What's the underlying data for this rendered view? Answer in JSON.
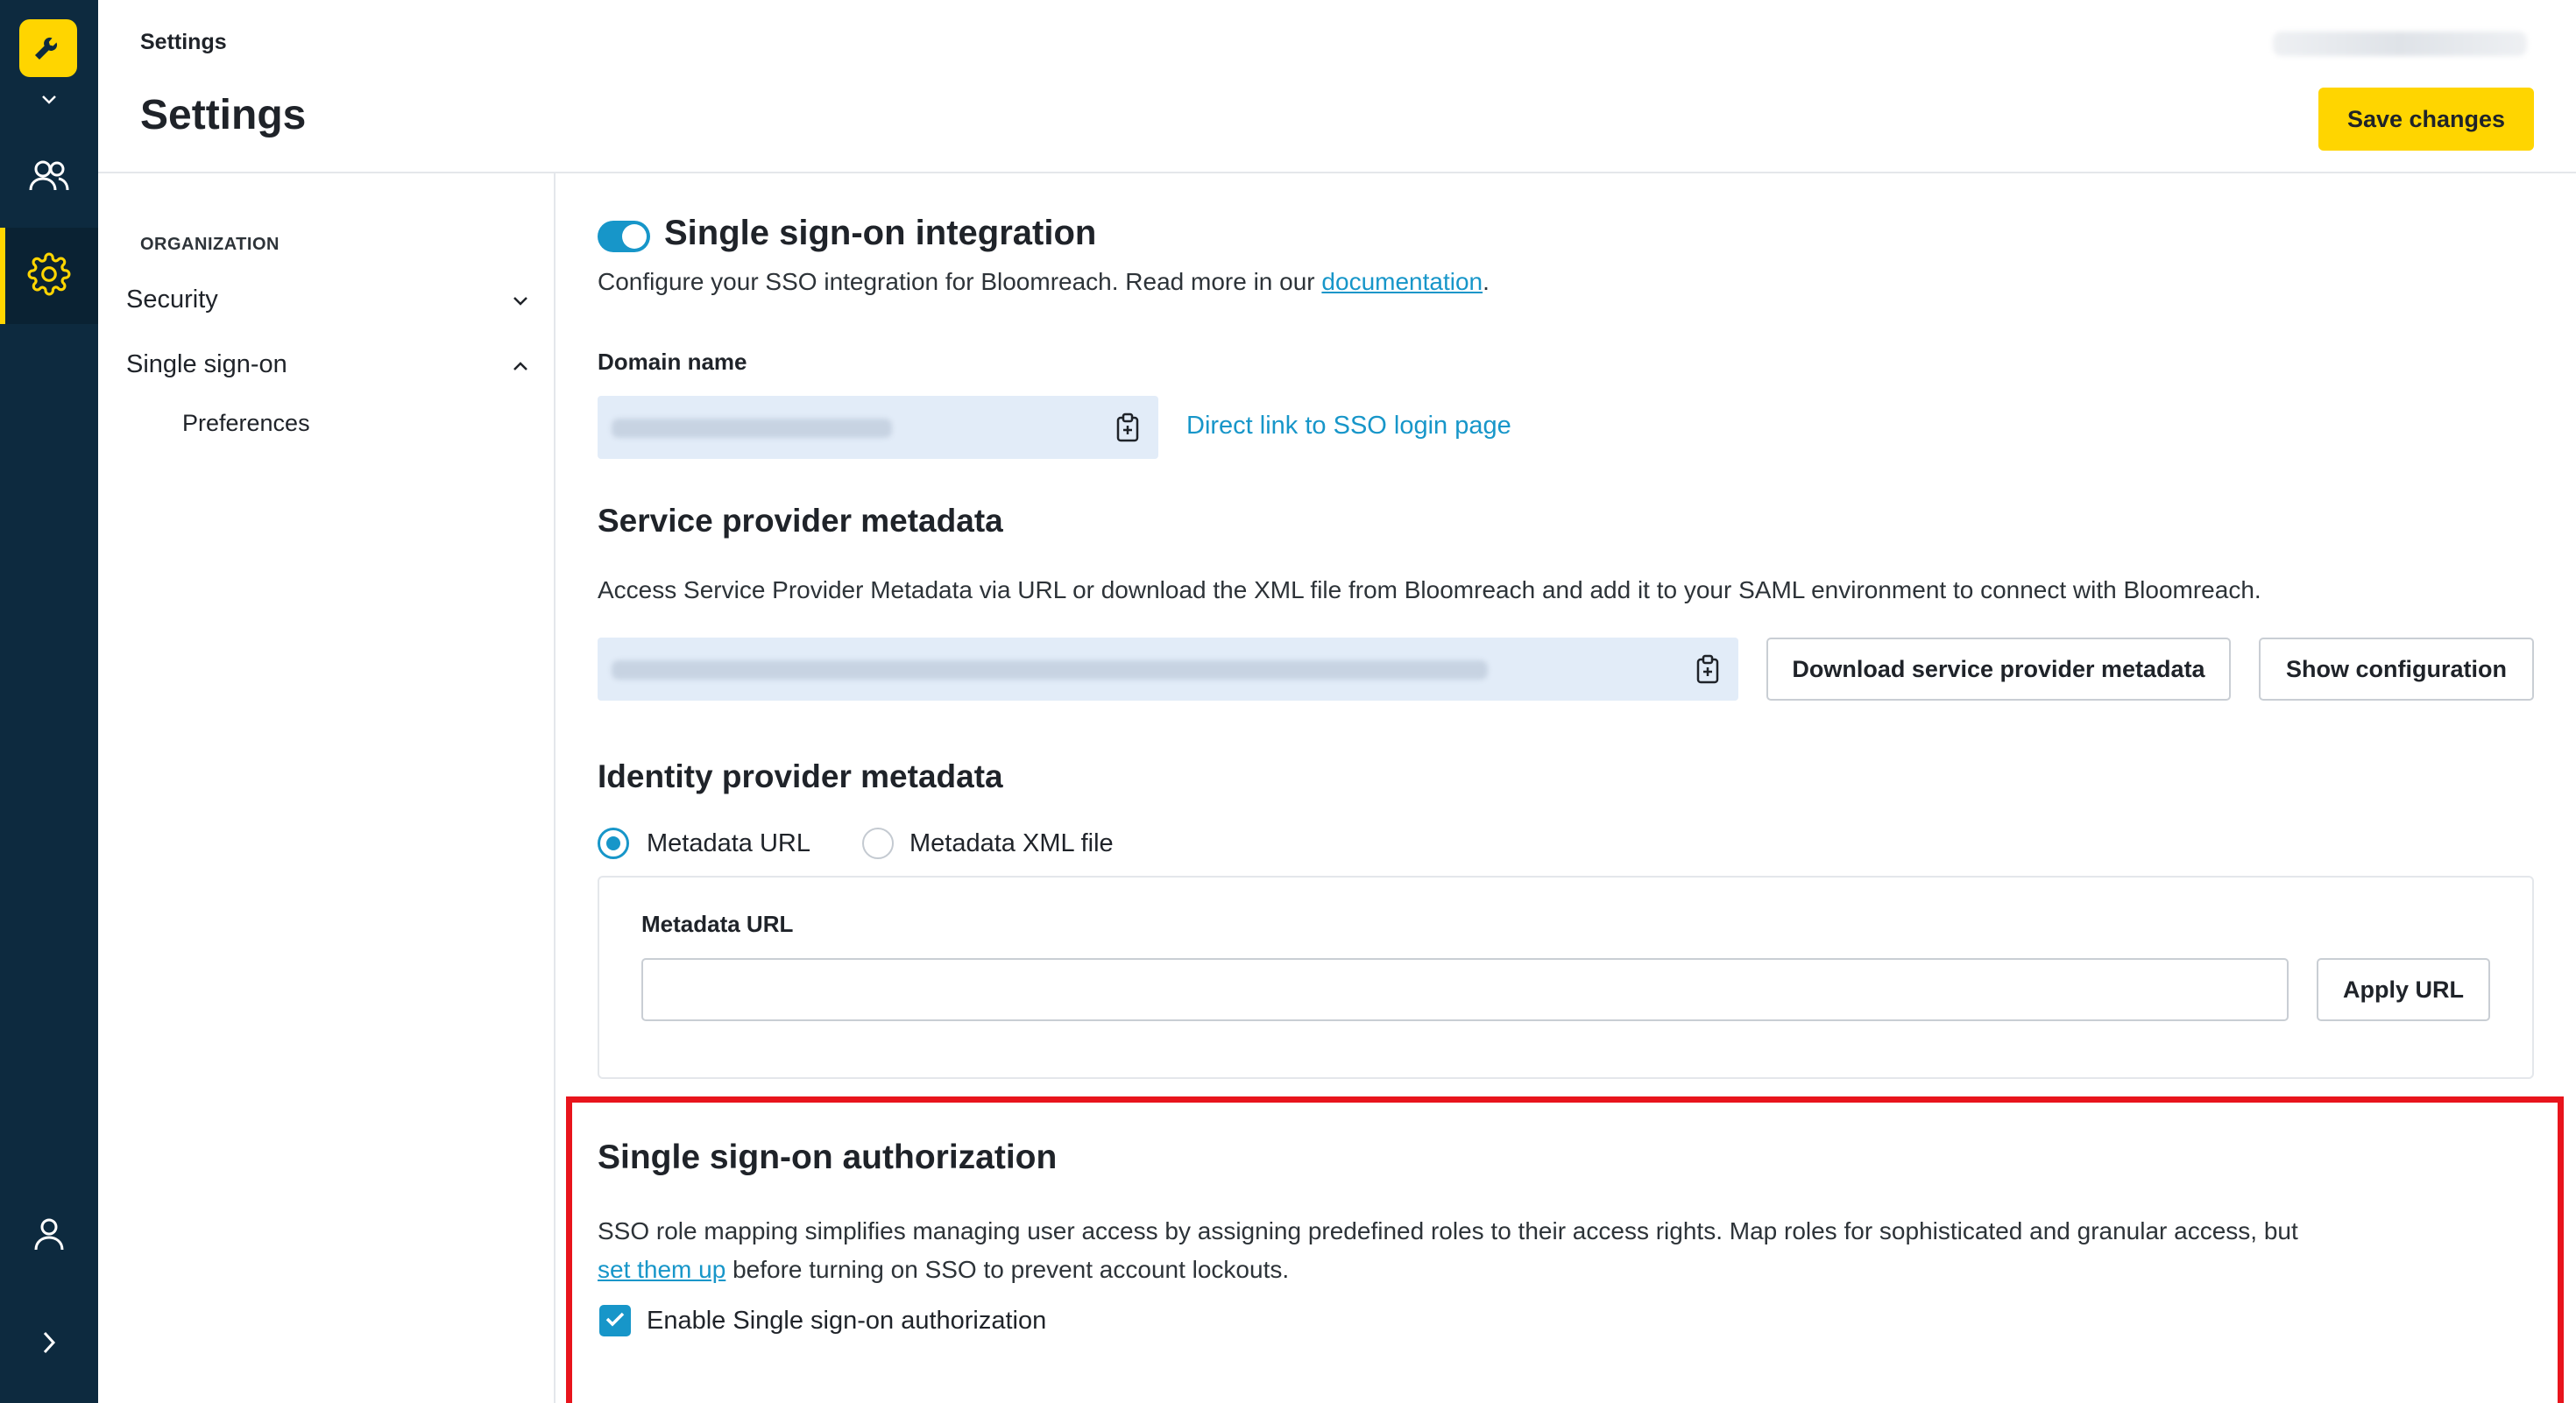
{
  "header": {
    "breadcrumb": "Settings",
    "title": "Settings",
    "save_label": "Save changes"
  },
  "rail": {
    "icons": [
      "wrench-icon",
      "chevron-down-icon",
      "users-icon",
      "gear-icon",
      "user-icon",
      "chevron-right-icon"
    ],
    "accent": "#ffd500",
    "background": "#0d2a3f"
  },
  "subnav": {
    "group": "ORGANIZATION",
    "items": [
      {
        "label": "Security",
        "expanded": false
      },
      {
        "label": "Single sign-on",
        "expanded": true
      }
    ],
    "sub_items": [
      "Preferences"
    ]
  },
  "sso": {
    "title": "Single sign-on integration",
    "enabled": true,
    "description_prefix": "Configure your SSO integration for Bloomreach. Read more in our ",
    "description_link": "documentation",
    "description_suffix": ".",
    "domain_label": "Domain name",
    "direct_link": "Direct link to SSO login page"
  },
  "sp_metadata": {
    "title": "Service provider metadata",
    "description": "Access Service Provider Metadata via URL or download the XML file from Bloomreach and add it to your SAML environment to connect with Bloomreach.",
    "download_label": "Download service provider metadata",
    "show_config_label": "Show configuration"
  },
  "idp_metadata": {
    "title": "Identity provider metadata",
    "options": [
      "Metadata URL",
      "Metadata XML file"
    ],
    "selected": "Metadata URL",
    "url_label": "Metadata URL",
    "url_value": "",
    "apply_label": "Apply URL"
  },
  "authorization": {
    "title": "Single sign-on authorization",
    "description_line1": "SSO role mapping simplifies managing user access by assigning predefined roles to their access rights. Map roles for sophisticated and granular access, but",
    "description_link": "set them up",
    "description_suffix": " before turning on SSO to prevent account lockouts.",
    "checkbox_label": "Enable Single sign-on authorization",
    "checkbox_checked": true,
    "highlight_color": "#e8141c"
  },
  "colors": {
    "link": "#1796c9",
    "primary_button": "#ffd500"
  }
}
